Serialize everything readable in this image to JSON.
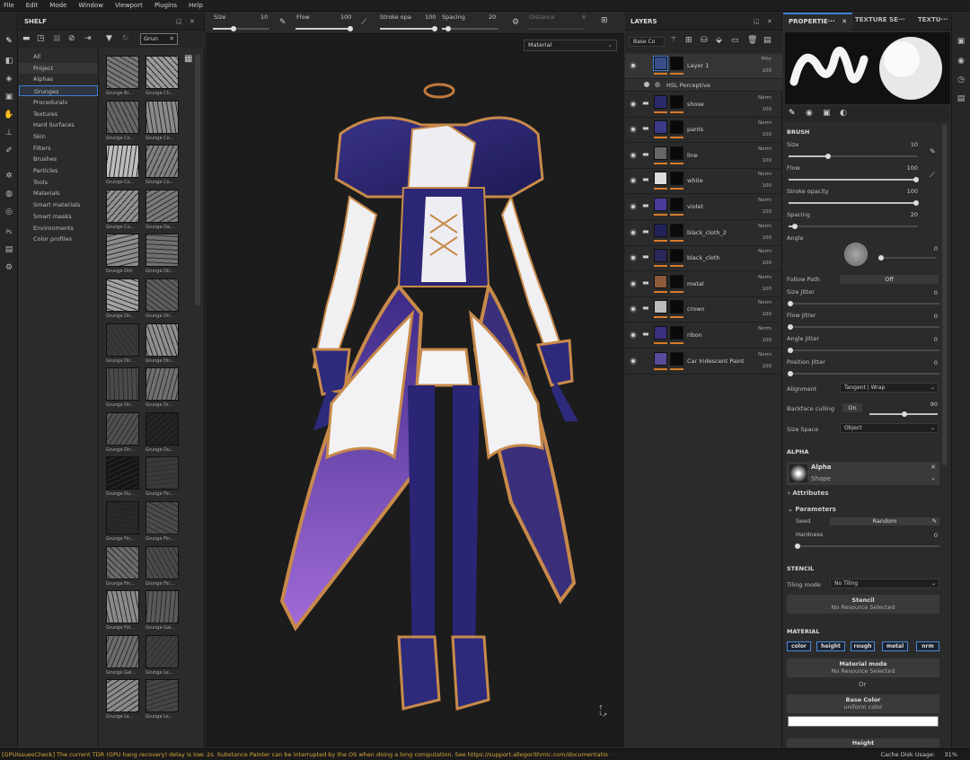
{
  "menu": [
    "File",
    "Edit",
    "Mode",
    "Window",
    "Viewport",
    "Plugins",
    "Help"
  ],
  "shelf": {
    "title": "SHELF",
    "search_value": "Grun",
    "categories": [
      "All",
      "Project",
      "Alphas",
      "Grunges",
      "Procedurals",
      "Textures",
      "Hard Surfaces",
      "Skin",
      "Filters",
      "Brushes",
      "Particles",
      "Tools",
      "Materials",
      "Smart materials",
      "Smart masks",
      "Environments",
      "Color profiles"
    ],
    "thumbs": [
      "Grunge Br...",
      "Grunge Ch...",
      "Grunge Co...",
      "Grunge Co...",
      "Grunge Co...",
      "Grunge Co...",
      "Grunge Co...",
      "Grunge Da...",
      "Grunge Dirt",
      "Grunge Dir...",
      "Grunge Dir...",
      "Grunge Dir...",
      "Grunge Dir...",
      "Grunge Dir...",
      "Grunge Dir...",
      "Grunge Dr...",
      "Grunge Dir...",
      "Grunge Du...",
      "Grunge Du...",
      "Grunge Fin...",
      "Grunge Fin...",
      "Grunge Fin...",
      "Grunge Fin...",
      "Grunge Fin...",
      "Grunge Fol...",
      "Grunge Gal...",
      "Grunge Gal...",
      "Grunge Le...",
      "Grunge Le...",
      "Grunge Le..."
    ]
  },
  "toolbar": {
    "size_label": "Size",
    "size_value": "10",
    "flow_label": "Flow",
    "flow_value": "100",
    "stroke_label": "Stroke opa",
    "stroke_value": "100",
    "spacing_label": "Spacing",
    "spacing_value": "20",
    "distance_label": "Distance",
    "distance_value": "6",
    "channel_value": "Material"
  },
  "layers": {
    "title": "LAYERS",
    "blend_mode": "Base Co",
    "effect": "HSL Perceptive",
    "items": [
      {
        "name": "Layer 1",
        "blend": "Pthr",
        "opacity": "100"
      },
      {
        "name": "shose",
        "blend": "Norm",
        "opacity": "100"
      },
      {
        "name": "pants",
        "blend": "Norm",
        "opacity": "100"
      },
      {
        "name": "line",
        "blend": "Norm",
        "opacity": "100"
      },
      {
        "name": "white",
        "blend": "Norm",
        "opacity": "100"
      },
      {
        "name": "violet",
        "blend": "Norm",
        "opacity": "100"
      },
      {
        "name": "black_cloth_2",
        "blend": "Norm",
        "opacity": "100"
      },
      {
        "name": "black_cloth",
        "blend": "Norm",
        "opacity": "100"
      },
      {
        "name": "metal",
        "blend": "Norm",
        "opacity": "100"
      },
      {
        "name": "crown",
        "blend": "Norm",
        "opacity": "100"
      },
      {
        "name": "ribon",
        "blend": "Norm",
        "opacity": "100"
      },
      {
        "name": "Car Iridescent Paint",
        "blend": "Norm",
        "opacity": "100"
      }
    ]
  },
  "props": {
    "tabs": [
      "PROPERTIE···",
      "TEXTURE SE···",
      "TEXTU···"
    ],
    "brush_title": "BRUSH",
    "size": {
      "label": "Size",
      "value": "10"
    },
    "flow": {
      "label": "Flow",
      "value": "100"
    },
    "stroke": {
      "label": "Stroke opacity",
      "value": "100"
    },
    "spacing": {
      "label": "Spacing",
      "value": "20"
    },
    "angle": {
      "label": "Angle",
      "value": "0"
    },
    "follow_path": {
      "label": "Follow Path",
      "value": "Off"
    },
    "size_jitter": {
      "label": "Size Jitter",
      "value": "0"
    },
    "flow_jitter": {
      "label": "Flow Jitter",
      "value": "0"
    },
    "angle_jitter": {
      "label": "Angle Jitter",
      "value": "0"
    },
    "position_jitter": {
      "label": "Position Jitter",
      "value": "0"
    },
    "alignment": {
      "label": "Alignment",
      "value": "Tangent | Wrap"
    },
    "backface": {
      "label": "Backface culling",
      "toggle": "On",
      "value": "90"
    },
    "size_space": {
      "label": "Size Space",
      "value": "Object"
    },
    "alpha_title": "ALPHA",
    "alpha_name": "Alpha",
    "alpha_sub": "Shape",
    "attributes": "Attributes",
    "parameters": "Parameters",
    "seed": {
      "label": "Seed",
      "value": "Random"
    },
    "hardness": {
      "label": "Hardness",
      "value": "0"
    },
    "stencil_title": "STENCIL",
    "tiling": {
      "label": "Tiling mode",
      "value": "No Tiling"
    },
    "stencil_btn": "Stencil",
    "stencil_sub": "No Resource Selected",
    "material_title": "MATERIAL",
    "channels": [
      "color",
      "height",
      "rough",
      "metal",
      "nrm"
    ],
    "material_mode": "Material mode",
    "material_mode_sub": "No Resource Selected",
    "or": "Or",
    "base_color": "Base Color",
    "base_color_sub": "uniform color",
    "height": "Height"
  },
  "status": {
    "message": "[GPUIssuesCheck] The current TDR (GPU hang recovery) delay is low: 2s. Substance Painter can be interrupted by the OS when doing a long computation. See https://support.allegorithmic.com/documentatio ·",
    "cache_label": "Cache Disk Usage:",
    "cache_value": "31%"
  },
  "colors": {
    "accent": "#3f7ed3",
    "orange": "#d97b29",
    "status": "#d9a73b"
  }
}
